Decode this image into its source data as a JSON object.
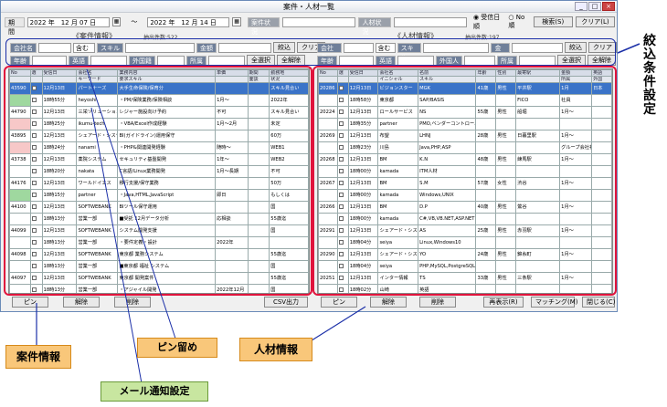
{
  "window": {
    "title": "案件・人材一覧"
  },
  "filter": {
    "period_label": "期間",
    "from_date": "2022 年　12 月 07 日",
    "tilde": "～",
    "to_date": "2022 年　12 月 14 日",
    "case_status_label": "案件状況",
    "talent_status_label": "人材状況",
    "radio_received": "受信日順",
    "radio_no": "No順",
    "search_button": "検索(S)",
    "clear_button": "クリア(L)"
  },
  "left": {
    "heading": "《案件情報》",
    "count": "抽出件数:522",
    "company_label": "会社名",
    "include_label": "含む",
    "skill_label": "スキル",
    "amount_label": "金額",
    "narrow_button": "絞込",
    "clear_button": "クリア",
    "age_label": "年齢",
    "english_label": "英語",
    "foreign_label": "外国籍",
    "affiliation_label": "所属",
    "all_select": "全選択",
    "all_release": "全解除",
    "columns1": [
      "No",
      "選",
      "受信日",
      "会社名",
      "業務内容",
      "単価",
      "期間",
      "勤務地"
    ],
    "columns2": [
      "",
      "",
      "",
      "キーワード",
      "要求スキル",
      "",
      "面談",
      "状況"
    ],
    "rows": [
      {
        "no": "43590",
        "date": "12月13日",
        "company": "パートナーズ",
        "task": "大手生命保険/保育分",
        "price": "",
        "term": "",
        "place": "スキル見合い",
        "cls": "sel"
      },
      {
        "no": "",
        "date": "18時55分",
        "company": "heyoshi",
        "task": "・PM/保険業務/保険相談",
        "price": "1月〜",
        "term": "",
        "place": "2022年",
        "cls": "green"
      },
      {
        "no": "44790",
        "date": "12月13日",
        "company": "三栄ソリューション",
        "task": "レジャー施設向け予約",
        "price": "不可",
        "term": "",
        "place": "スキル見合い",
        "cls": ""
      },
      {
        "no": "",
        "date": "18時25分",
        "company": "ikumu-tech",
        "task": "・VBA/Excel作成経験",
        "price": "1月〜2月",
        "term": "",
        "place": "未定",
        "cls": "pink"
      },
      {
        "no": "43895",
        "date": "12月13日",
        "company": "シェアード・システム",
        "task": "BI(ガイドライン)運用保守",
        "price": "",
        "term": "",
        "place": "60万",
        "cls": ""
      },
      {
        "no": "",
        "date": "18時24分",
        "company": "nanami",
        "task": "・PHP&関連開発経験",
        "price": "随時〜",
        "term": "",
        "place": "WEB1",
        "cls": "pink"
      },
      {
        "no": "43738",
        "date": "12月13日",
        "company": "薬院システム",
        "task": "セキュリティ基盤開発",
        "price": "1年〜",
        "term": "",
        "place": "WEB2",
        "cls": ""
      },
      {
        "no": "",
        "date": "18時20分",
        "company": "nakata",
        "task": "C言語/Linux業務開発",
        "price": "1月〜長期",
        "term": "",
        "place": "不可",
        "cls": ""
      },
      {
        "no": "44176",
        "date": "12月13日",
        "company": "ワールドイエス",
        "task": "移行支援/保守業務",
        "price": "",
        "term": "",
        "place": "50万",
        "cls": ""
      },
      {
        "no": "",
        "date": "18時15分",
        "company": "partner",
        "task": "・Java,HTML,JavaScript",
        "price": "即日",
        "term": "",
        "place": "もしくは",
        "cls": "green"
      },
      {
        "no": "44100",
        "date": "12月13日",
        "company": "SOFTWEBANK",
        "task": "BIツール保守運用",
        "price": "",
        "term": "",
        "place": "国",
        "cls": ""
      },
      {
        "no": "",
        "date": "18時13分",
        "company": "営業一部",
        "task": "■受託 12月データ分析",
        "price": "応相談",
        "term": "",
        "place": "55歳迄",
        "cls": ""
      },
      {
        "no": "44099",
        "date": "12月13日",
        "company": "SOFTWEBANK",
        "task": "システム開発支援",
        "price": "",
        "term": "",
        "place": "国",
        "cls": ""
      },
      {
        "no": "",
        "date": "18時13分",
        "company": "営業一部",
        "task": "・要件定義・設計",
        "price": "2022年",
        "term": "",
        "place": "",
        "cls": ""
      },
      {
        "no": "44098",
        "date": "12月13日",
        "company": "SOFTWEBANK",
        "task": "東京都 業務システム",
        "price": "",
        "term": "",
        "place": "55歳迄",
        "cls": ""
      },
      {
        "no": "",
        "date": "18時13分",
        "company": "営業一部",
        "task": "■東京都 福祉 システム",
        "price": "",
        "term": "",
        "place": "国",
        "cls": ""
      },
      {
        "no": "44097",
        "date": "12月13日",
        "company": "SOFTWEBANK",
        "task": "東京都 開発案件",
        "price": "",
        "term": "",
        "place": "55歳迄",
        "cls": ""
      },
      {
        "no": "",
        "date": "18時13分",
        "company": "営業一部",
        "task": "・アジャイル開発",
        "price": "2022年12月",
        "term": "",
        "place": "国",
        "cls": ""
      }
    ],
    "pin_button": "ピン",
    "delete_button": "削除",
    "release_button": "解除",
    "csv_button": "CSV出力"
  },
  "right": {
    "heading": "《人材情報》",
    "count": "抽出件数:197",
    "company_label": "会社名",
    "include_label": "含む",
    "skill_label": "スキル",
    "amount_label": "金額",
    "narrow_button": "絞込",
    "clear_button": "クリア",
    "age_label": "年齢",
    "english_label": "英語",
    "foreign_label": "外国人",
    "affiliation_label": "所属",
    "all_select": "全選択",
    "all_release": "全解除",
    "columns1": [
      "No",
      "選",
      "受信日",
      "会社名",
      "名前",
      "年齢",
      "性別",
      "最寄駅",
      "金額",
      "英語"
    ],
    "columns2": [
      "",
      "",
      "",
      "イニシャル",
      "スキル",
      "",
      "",
      "",
      "所属",
      "外国"
    ],
    "rows": [
      {
        "no": "20286",
        "date": "12月13日",
        "company": "ビジョンスター",
        "name": "MGK",
        "age": "41歳",
        "sex": "男性",
        "station": "平井駅",
        "price": "1月",
        "lang": "日本",
        "cls": "sel"
      },
      {
        "no": "",
        "date": "18時58分",
        "company": "東京都",
        "name": "SAP/BASIS",
        "age": "",
        "sex": "",
        "station": "FICO",
        "price": "社員",
        "lang": "",
        "cls": ""
      },
      {
        "no": "20224",
        "date": "12月13日",
        "company": "ロールサービス",
        "name": "NS",
        "age": "55歳",
        "sex": "男性",
        "station": "船堀",
        "price": "1月〜",
        "lang": "",
        "cls": ""
      },
      {
        "no": "",
        "date": "18時35分",
        "company": "partner",
        "name": "PMO,ベンダーコントロール",
        "age": "",
        "sex": "",
        "station": "",
        "price": "",
        "lang": "",
        "cls": ""
      },
      {
        "no": "20269",
        "date": "12月13日",
        "company": "布望",
        "name": "LHNJ",
        "age": "28歳",
        "sex": "男性",
        "station": "日暮里駅",
        "price": "1月〜",
        "lang": "",
        "cls": ""
      },
      {
        "no": "",
        "date": "18時23分",
        "company": "川島",
        "name": "Java,PHP,ASP",
        "age": "",
        "sex": "",
        "station": "",
        "price": "グループ会社社員",
        "lang": "",
        "cls": ""
      },
      {
        "no": "20268",
        "date": "12月13日",
        "company": "BM",
        "name": "K.N",
        "age": "48歳",
        "sex": "男性",
        "station": "練馬駅",
        "price": "1月〜",
        "lang": "",
        "cls": ""
      },
      {
        "no": "",
        "date": "18時00分",
        "company": "kamada",
        "name": "ITM人材",
        "age": "",
        "sex": "",
        "station": "",
        "price": "",
        "lang": "",
        "cls": ""
      },
      {
        "no": "20267",
        "date": "12月13日",
        "company": "BM",
        "name": "S.M",
        "age": "57歳",
        "sex": "女性",
        "station": "渋谷",
        "price": "1月〜",
        "lang": "",
        "cls": ""
      },
      {
        "no": "",
        "date": "18時00分",
        "company": "kamada",
        "name": "Windows,UNIX",
        "age": "",
        "sex": "",
        "station": "",
        "price": "",
        "lang": "",
        "cls": ""
      },
      {
        "no": "20266",
        "date": "12月13日",
        "company": "BM",
        "name": "D.P",
        "age": "40歳",
        "sex": "男性",
        "station": "鶯谷",
        "price": "1月〜",
        "lang": "",
        "cls": ""
      },
      {
        "no": "",
        "date": "18時00分",
        "company": "kamada",
        "name": "C#,VB,VB.NET,ASP.NET",
        "age": "",
        "sex": "",
        "station": "",
        "price": "",
        "lang": "",
        "cls": ""
      },
      {
        "no": "20291",
        "date": "12月13日",
        "company": "シェアード・システム",
        "name": "AS",
        "age": "25歳",
        "sex": "男性",
        "station": "赤羽駅",
        "price": "1月〜",
        "lang": "",
        "cls": ""
      },
      {
        "no": "",
        "date": "18時04分",
        "company": "seiya",
        "name": "Linux,Windows10",
        "age": "",
        "sex": "",
        "station": "",
        "price": "",
        "lang": "",
        "cls": ""
      },
      {
        "no": "20290",
        "date": "12月13日",
        "company": "シェアード・システム",
        "name": "YO",
        "age": "24歳",
        "sex": "男性",
        "station": "錦糸町",
        "price": "1月〜",
        "lang": "",
        "cls": ""
      },
      {
        "no": "",
        "date": "18時04分",
        "company": "seiya",
        "name": "PHP,MySQL,PostgreSQL",
        "age": "",
        "sex": "",
        "station": "",
        "price": "",
        "lang": "",
        "cls": ""
      },
      {
        "no": "20251",
        "date": "12月13日",
        "company": "インター情報",
        "name": "TS",
        "age": "33歳",
        "sex": "男性",
        "station": "三条駅",
        "price": "1月〜",
        "lang": "",
        "cls": ""
      },
      {
        "no": "",
        "date": "18時02分",
        "company": "山崎",
        "name": "英語",
        "age": "",
        "sex": "",
        "station": "",
        "price": "",
        "lang": "",
        "cls": ""
      },
      {
        "no": "20292",
        "date": "12月13日",
        "company": "シェアード・システム",
        "name": "SO",
        "age": "28歳",
        "sex": "男性",
        "station": "武蔵小杉",
        "price": "1月〜",
        "lang": "",
        "cls": ""
      },
      {
        "no": "",
        "date": "18時04分",
        "company": "seiya",
        "name": "Java,VB,Python,YAML",
        "age": "",
        "sex": "",
        "station": "",
        "price": "",
        "lang": "",
        "cls": ""
      }
    ],
    "pin_button": "ピン",
    "delete_button": "削除",
    "release_button": "解除",
    "resend_button": "再表示(R)",
    "matching_button": "マッチング(M)",
    "close_button": "閉じる(C)"
  },
  "annotations": {
    "filter_setting": "絞込条件設定",
    "case_info": "案件情報",
    "pin": "ピン留め",
    "talent_info": "人材情報",
    "mail": "メール通知設定"
  }
}
